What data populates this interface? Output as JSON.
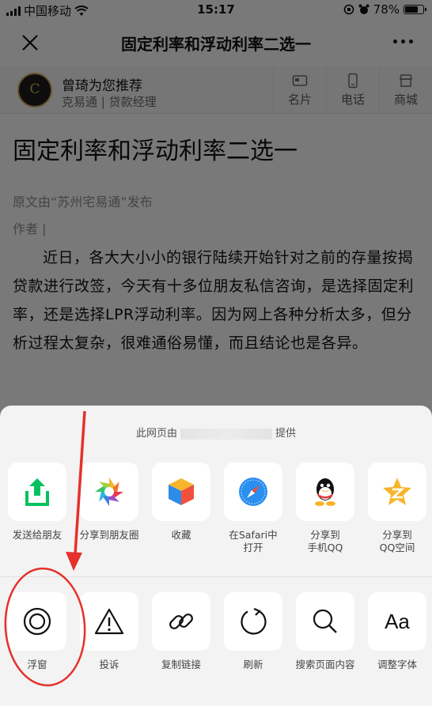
{
  "status_bar": {
    "carrier": "中国移动",
    "time": "15:17",
    "battery": "78%",
    "battery_level": 0.78
  },
  "nav": {
    "title": "固定利率和浮动利率二选一"
  },
  "promo": {
    "name": "曾琦为您推荐",
    "role": "克易通 | 贷款经理",
    "actions": [
      "名片",
      "电话",
      "商城"
    ]
  },
  "article": {
    "title": "固定利率和浮动利率二选一",
    "source": "原文由“苏州宅易通”发布",
    "author": "作者 |",
    "body": "近日，各大大小小的银行陆续开始针对之前的存量按揭贷款进行改签，今天有十多位朋友私信咨询，是选择固定利率，还是选择LPR浮动利率。因为网上各种分析太多，但分析过程太复杂，很难通俗易懂，而且结论也是各异。"
  },
  "sheet": {
    "provided_prefix": "此网页由",
    "provided_suffix": "提供",
    "share_items": [
      {
        "label": "发送给朋友",
        "icon": "send-to-friend-icon"
      },
      {
        "label": "分享到朋友圈",
        "icon": "moments-icon"
      },
      {
        "label": "收藏",
        "icon": "favorite-icon"
      },
      {
        "label": "在Safari中\n打开",
        "icon": "safari-icon"
      },
      {
        "label": "分享到\n手机QQ",
        "icon": "qq-icon"
      },
      {
        "label": "分享到\nQQ空间",
        "icon": "qzone-icon"
      }
    ],
    "action_items": [
      {
        "label": "浮窗",
        "icon": "floating-window-icon"
      },
      {
        "label": "投诉",
        "icon": "warning-icon"
      },
      {
        "label": "复制链接",
        "icon": "link-icon"
      },
      {
        "label": "刷新",
        "icon": "refresh-icon"
      },
      {
        "label": "搜索页面内容",
        "icon": "search-icon"
      },
      {
        "label": "调整字体",
        "icon": "font-size-icon"
      }
    ],
    "font_glyph": "Aa"
  },
  "colors": {
    "wechat_green": "#07c160",
    "annotation_red": "#e5312c"
  }
}
